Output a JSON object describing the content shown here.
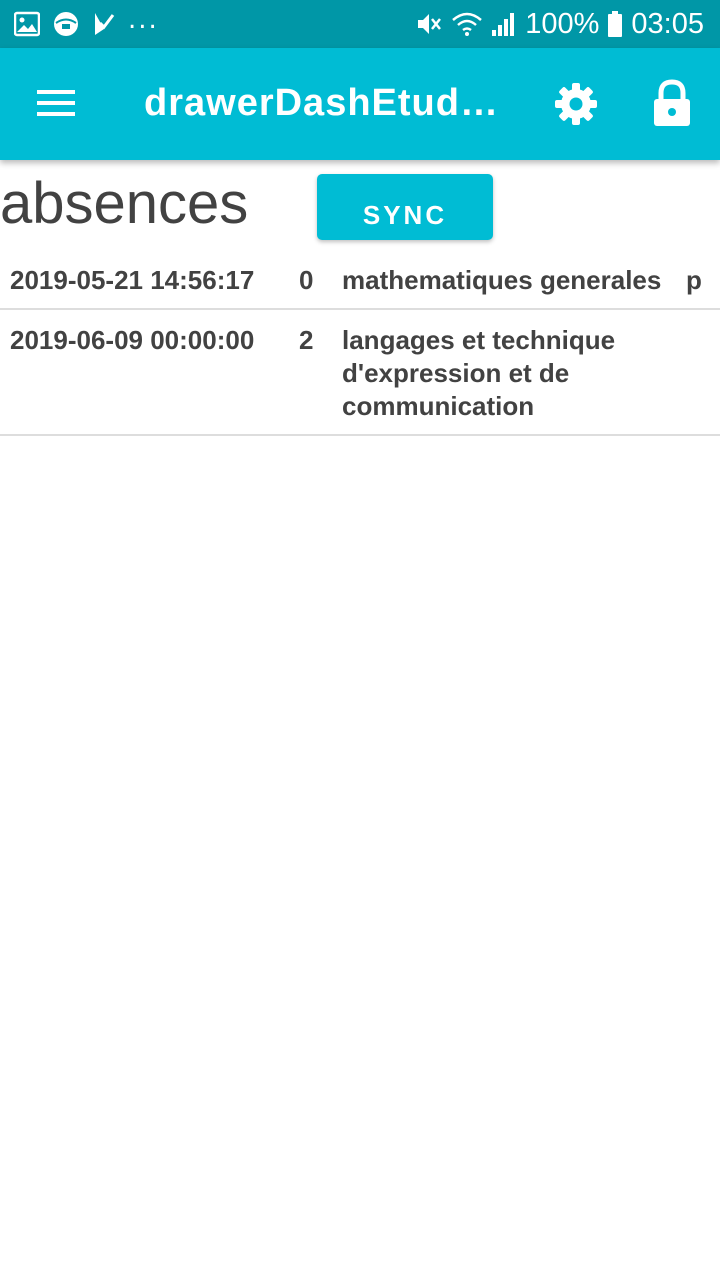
{
  "status_bar": {
    "icons_left": [
      "image-icon",
      "app-logo-icon",
      "check-flag-icon"
    ],
    "more": "...",
    "battery": "100%",
    "time": "03:05"
  },
  "app_bar": {
    "title": "drawerDashEtudiant"
  },
  "page": {
    "title": "absences",
    "sync_label": "SYNC"
  },
  "absences": [
    {
      "date": "2019-05-21 14:56:17",
      "count": "0",
      "subject": "mathematiques generales",
      "extra": "p"
    },
    {
      "date": "2019-06-09 00:00:00",
      "count": "2",
      "subject": "langages et technique d'expression et de communication",
      "extra": ""
    }
  ],
  "colors": {
    "status_bar": "#0097a7",
    "app_bar": "#00bcd4",
    "text": "#424242"
  }
}
